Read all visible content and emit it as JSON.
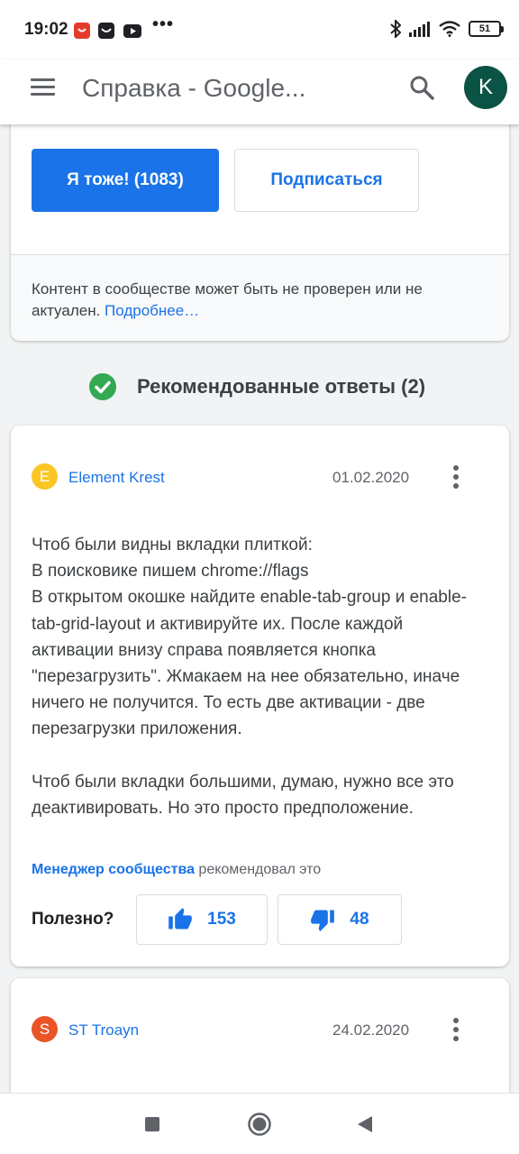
{
  "status_bar": {
    "time": "19:02",
    "dots": "•••",
    "battery": "51",
    "icons": [
      "aliexpress-icon",
      "inbox-icon",
      "youtube-icon",
      "bluetooth-icon",
      "signal-icon",
      "wifi-icon",
      "battery-icon"
    ]
  },
  "app_bar": {
    "title": "Справка - Google...",
    "avatar_letter": "K",
    "avatar_color": "#0b5345"
  },
  "question": {
    "me_too_label": "Я тоже! (1083)",
    "subscribe_label": "Подписаться",
    "notice_text": "Контент в сообществе может быть не проверен или не актуален.",
    "notice_link": "Подробнее…"
  },
  "recommended": {
    "title": "Рекомендованные ответы (2)"
  },
  "answers": [
    {
      "author": "Element Krest",
      "initial": "E",
      "avatar_color": "#f9c623",
      "date": "01.02.2020",
      "paragraphs": [
        "Чтоб были видны вкладки плиткой:\nВ поисковике пишем chrome://flags\nВ открытом окошке найдите enable-tab-group и enable-tab-grid-layout и активируйте их. После каждой активации внизу справа появляется кнопка \"перезагрузить\". Жмакаем на нее обязательно, иначе ничего не получится. То есть две активации - две перезагрузки приложения.",
        "Чтоб были вкладки большими, думаю, нужно все это деактивировать. Но это просто предположение."
      ],
      "recommended_by_link": "Менеджер сообщества",
      "recommended_by_text": " рекомендовал это",
      "helpful_label": "Полезно?",
      "upvotes": "153",
      "downvotes": "48"
    },
    {
      "author": "ST Troayn",
      "initial": "S",
      "avatar_color": "#ea5428",
      "date": "24.02.2020"
    }
  ],
  "colors": {
    "accent": "#1a73e8",
    "check": "#34a853"
  }
}
